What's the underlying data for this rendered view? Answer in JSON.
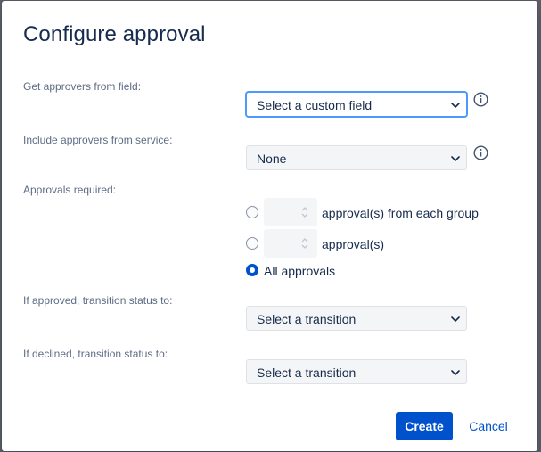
{
  "dialog": {
    "title": "Configure approval",
    "fields": {
      "approvers_field": {
        "label": "Get approvers from field:",
        "value": "Select a custom field"
      },
      "approvers_service": {
        "label": "Include approvers from service:",
        "value": "None"
      },
      "approvals_required": {
        "label": "Approvals required:",
        "options": [
          {
            "text": "approval(s) from each group",
            "checked": false
          },
          {
            "text": "approval(s)",
            "checked": false
          },
          {
            "text": "All approvals",
            "checked": true
          }
        ]
      },
      "approved_transition": {
        "label": "If approved, transition status to:",
        "value": "Select a transition"
      },
      "declined_transition": {
        "label": "If declined, transition status to:",
        "value": "Select a transition"
      }
    },
    "buttons": {
      "create": "Create",
      "cancel": "Cancel"
    }
  },
  "icons": {
    "info": "info-icon",
    "chevron": "chevron-down-icon",
    "spinner": "spinner-arrows-icon"
  },
  "colors": {
    "primary": "#0052cc",
    "text": "#172b4d",
    "label": "#5e6c84",
    "focus": "#4c9aff"
  }
}
